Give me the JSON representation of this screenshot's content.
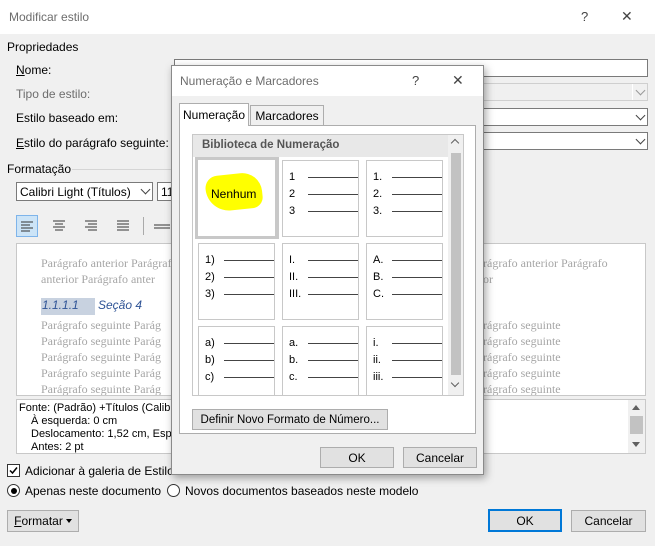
{
  "main_dialog": {
    "title": "Modificar estilo",
    "help_icon": "?",
    "close_icon": "✕",
    "props_section": "Propriedades",
    "name_label": "Nome:",
    "style_type_label": "Tipo de estilo:",
    "based_on_label": "Estilo baseado em:",
    "next_style_label": "Estilo do parágrafo seguinte:",
    "format_section": "Formatação",
    "font_name": "Calibri Light (Títulos)",
    "font_size": "11",
    "preview": {
      "prev_line1_left": "Parágrafo anterior Parágrafo",
      "prev_line2_left": "anterior Parágrafo anter",
      "prev_line1_right": "rágrafo anterior Parágrafo",
      "prev_line2_right": "or",
      "heading_number": "1.1.1.1",
      "heading_text": "Seção 4",
      "next_left": [
        "Parágrafo seguinte Parág",
        "Parágrafo seguinte Parág",
        "Parágrafo seguinte Parág",
        "Parágrafo seguinte Parág",
        "Parágrafo seguinte Parág"
      ],
      "next_right": [
        "rágrafo seguinte",
        "rágrafo seguinte",
        "rágrafo seguinte",
        "rágrafo seguinte",
        "rágrafo seguinte"
      ]
    },
    "description_lines": [
      "Fonte: (Padrão) +Títulos (Calib",
      "À esquerda:  0 cm",
      "Deslocamento:  1,52 cm, Esp",
      "Antes:  2 pt"
    ],
    "add_to_gallery_label": "Adicionar à galeria de Estilos",
    "only_this_doc_label": "Apenas neste documento",
    "new_docs_label": "Novos documentos baseados neste modelo",
    "format_button": "Formatar",
    "ok_button": "OK",
    "cancel_button": "Cancelar"
  },
  "numbering_dialog": {
    "title": "Numeração e Marcadores",
    "help_icon": "?",
    "close_icon": "✕",
    "tabs": [
      {
        "label": "Numeração",
        "active": true
      },
      {
        "label": "Marcadores",
        "active": false
      }
    ],
    "library_header": "Biblioteca de Numeração",
    "none_label": "Nenhum",
    "tiles": [
      [
        "1",
        "2",
        "3"
      ],
      [
        "1.",
        "2.",
        "3."
      ],
      [
        "1)",
        "2)",
        "3)"
      ],
      [
        "I.",
        "II.",
        "III."
      ],
      [
        "A.",
        "B.",
        "C."
      ],
      [
        "a)",
        "b)",
        "c)"
      ],
      [
        "a.",
        "b.",
        "c."
      ],
      [
        "i.",
        "ii.",
        "iii."
      ]
    ],
    "define_button": "Definir Novo Formato de Número...",
    "ok_button": "OK",
    "cancel_button": "Cancelar"
  },
  "colors": {
    "accent": "#0078d7",
    "highlight": "#ffff00",
    "selected_tile": "#c8c8c8",
    "preview_gray": "#a6a6a6",
    "heading_blue": "#2f5496"
  }
}
